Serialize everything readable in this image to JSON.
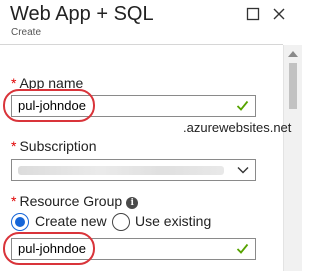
{
  "header": {
    "title": "Web App + SQL",
    "subtitle": "Create"
  },
  "form": {
    "app_name": {
      "label": "App name",
      "required": "*",
      "value": "pul-johndoe",
      "suffix": ".azurewebsites.net"
    },
    "subscription": {
      "label": "Subscription",
      "required": "*"
    },
    "resource_group": {
      "label": "Resource Group",
      "required": "*",
      "info_icon": "i",
      "options": [
        {
          "label": "Create new",
          "selected": true
        },
        {
          "label": "Use existing",
          "selected": false
        }
      ],
      "value": "pul-johndoe"
    }
  },
  "colors": {
    "required": "#e00000",
    "valid_check": "#57a300",
    "radio_selected": "#1565d8",
    "annotation": "#d9343a"
  },
  "icons": {
    "maximize": "square-icon",
    "close": "close-icon",
    "valid": "checkmark-icon",
    "dropdown": "chevron-down-icon",
    "info": "info-icon"
  }
}
